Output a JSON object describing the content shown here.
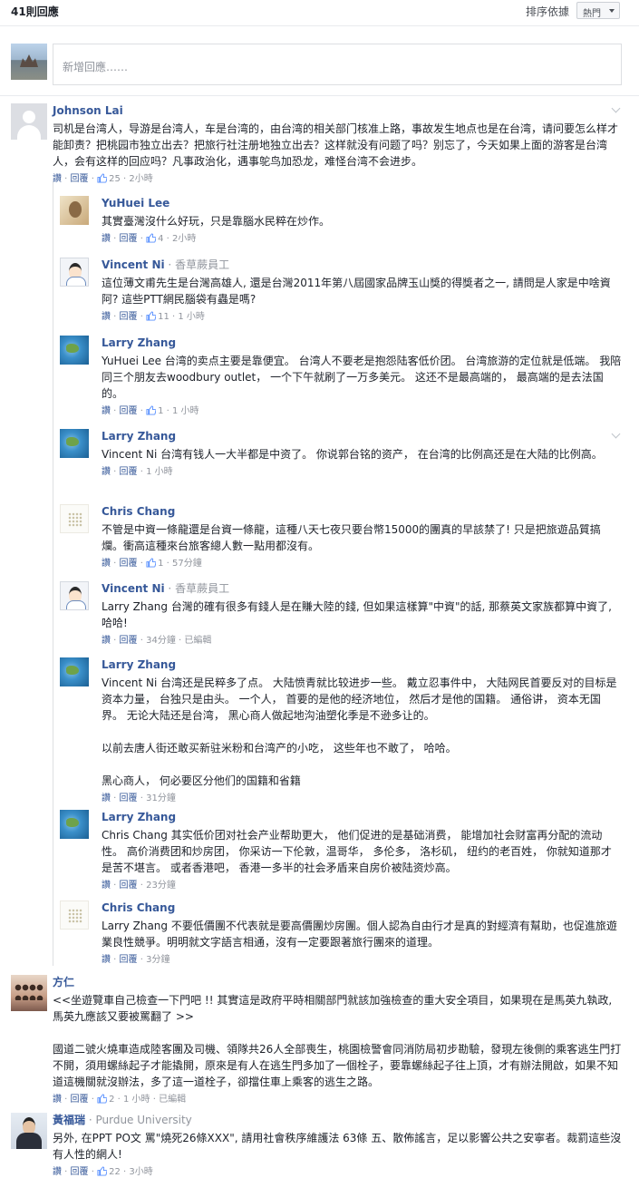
{
  "header": {
    "count": "41則回應",
    "sort_label": "排序依據",
    "sort_value": "熱門"
  },
  "new_comment": {
    "placeholder": "新增回應……"
  },
  "labels": {
    "like": "讚",
    "reply": "回覆",
    "dot": "·",
    "edited": "已編輯"
  },
  "comments": [
    {
      "author": "Johnson Lai",
      "author_sub": "",
      "text": [
        "司机是台湾人，导游是台湾人，车是台湾的，由台湾的相关部门核准上路，事故发生地点也是在台湾，请问要怎么样才能卸责？把桃园市独立出去？把旅行社注册地独立出去？这样就没有问题了吗？别忘了，今天如果上面的游客是台湾人，会有这样的回应吗？凡事政治化，遇事鸵鸟加恐龙，难怪台湾不会进步。"
      ],
      "likes": "25",
      "time": "2小時",
      "edited": false
    },
    {
      "author": "YuHuei Lee",
      "author_sub": "",
      "text": [
        "其實臺灣沒什么好玩，只是靠腦水民粹在炒作。"
      ],
      "likes": "4",
      "time": "2小時",
      "edited": false
    },
    {
      "author": "Vincent Ni",
      "author_sub": "香草蕨員工",
      "text": [
        "這位薄文甫先生是台灣高雄人, 還是台灣2011年第八屆國家品牌玉山獎的得獎者之一, 請問是人家是中啥資阿? 這些PTT網民腦袋有蟲是嗎?"
      ],
      "likes": "11",
      "time": "1 小時",
      "edited": false
    },
    {
      "author": "Larry Zhang",
      "author_sub": "",
      "text": [
        "YuHuei Lee 台湾的卖点主要是靠便宜。 台湾人不要老是抱怨陆客低价团。 台湾旅游的定位就是低端。 我陪同三个朋友去woodbury outlet， 一个下午就刷了一万多美元。 这还不是最高端的， 最高端的是去法国的。"
      ],
      "likes": "1",
      "time": "1 小時",
      "edited": false
    },
    {
      "author": "Larry Zhang",
      "author_sub": "",
      "text": [
        "Vincent Ni 台湾有钱人一大半都是中资了。 你说郭台铭的资产， 在台湾的比例高还是在大陆的比例高。"
      ],
      "likes": "",
      "time": "1 小時",
      "edited": false
    },
    {
      "author": "Chris Chang",
      "author_sub": "",
      "text": [
        "不管是中資一條龍還是台資一條龍，這種八天七夜只要台幣15000的團真的早該禁了! 只是把旅遊品質搞爛。衝高這種來台旅客總人數一點用都沒有。"
      ],
      "likes": "1",
      "time": "57分鐘",
      "edited": false
    },
    {
      "author": "Vincent Ni",
      "author_sub": "香草蕨員工",
      "text": [
        "Larry Zhang 台灣的確有很多有錢人是在賺大陸的錢, 但如果這樣算\"中資\"的話, 那蔡英文家族都算中資了, 哈哈!"
      ],
      "likes": "",
      "time": "34分鐘",
      "edited": true
    },
    {
      "author": "Larry Zhang",
      "author_sub": "",
      "text": [
        "Vincent Ni 台湾还是民粹多了点。 大陆愤青就比较进步一些。 戴立忍事件中， 大陆网民首要反对的目标是资本力量， 台独只是由头。 一个人， 首要的是他的经济地位， 然后才是他的国籍。 通俗讲， 资本无国界。 无论大陆还是台湾， 黑心商人做起地沟油塑化季是不逊多让的。",
        "以前去唐人街还敢买新驻米粉和台湾产的小吃， 这些年也不敢了， 哈哈。",
        "黑心商人， 何必要区分他们的国籍和省籍"
      ],
      "likes": "",
      "time": "31分鐘",
      "edited": false
    },
    {
      "author": "Larry Zhang",
      "author_sub": "",
      "text": [
        "Chris Chang 其实低价团对社会产业帮助更大， 他们促进的是基础消费， 能增加社会财富再分配的流动性。 高价消费团和炒房团， 你采访一下伦敦，温哥华， 多伦多， 洛杉矶， 纽约的老百姓， 你就知道那才是苦不堪言。 或者香港吧， 香港一多半的社会矛盾来自房价被陆资炒高。"
      ],
      "likes": "",
      "time": "23分鐘",
      "edited": false
    },
    {
      "author": "Chris Chang",
      "author_sub": "",
      "text": [
        "Larry Zhang 不要低價團不代表就是要高價團炒房團。個人認為自由行才是真的對經濟有幫助，也促進旅遊業良性競爭。明明就文字語言相通，沒有一定要跟著旅行團來的道理。"
      ],
      "likes": "",
      "time": "3分鐘",
      "edited": false
    },
    {
      "author": "方仁",
      "author_sub": "",
      "text": [
        "<<坐遊覽車自己檢查一下門吧 !! 其實這是政府平時相關部門就該加強檢查的重大安全項目，如果現在是馬英九執政, 馬英九應該又要被罵翻了 >>",
        "國道二號火燒車造成陸客團及司機、領隊共26人全部喪生，桃園檢警會同消防局初步勘驗，發現左後側的乘客逃生門打不開，須用螺絲起子才能撬開，原來是有人在逃生門多加了一個栓子，要靠螺絲起子往上頂，才有辦法開啟，如果不知道這機關就沒辦法，多了這一道栓子，卻擋住車上乘客的逃生之路。"
      ],
      "likes": "2",
      "time": "1 小時",
      "edited": true
    },
    {
      "author": "黃福瑞",
      "author_sub": "Purdue University",
      "text": [
        "另外, 在PPT PO文 罵\"燒死26條XXX\", 請用社會秩序維護法 63條 五、散佈謠言，足以影響公共之安寧者。裁罰這些沒有人性的網人!"
      ],
      "likes": "22",
      "time": "3小時",
      "edited": false
    }
  ]
}
